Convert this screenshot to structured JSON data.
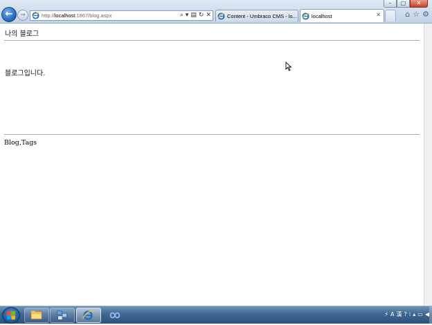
{
  "browser": {
    "window_controls": {
      "minimize": "–",
      "maximize": "□",
      "close": "✕"
    },
    "back_glyph": "←",
    "forward_glyph": "→",
    "url_prefix": "http://",
    "url_host": "localhost",
    "url_rest": ":1867/blog.aspx",
    "address_tools": [
      "⌕",
      "▾",
      "▤",
      "↻",
      "✕"
    ],
    "tabs": [
      {
        "title": "Content - Umbraco CMS - lo...",
        "active": false
      },
      {
        "title": "localhost",
        "active": true,
        "close": "✕"
      }
    ],
    "right_icons": [
      "⌂",
      "☆",
      "⚙"
    ]
  },
  "page": {
    "site_title": "나의 블로그",
    "body_text": "블로그입니다.",
    "footer_text": "Blog,Tags"
  },
  "taskbar": {
    "buttons": [
      {
        "name": "explorer",
        "active": false
      },
      {
        "name": "app",
        "active": false
      },
      {
        "name": "internet-explorer",
        "active": true
      },
      {
        "name": "visual-studio",
        "active": false
      }
    ],
    "tray": [
      "⚡",
      "A",
      "漢",
      "?",
      "⁞",
      "▴",
      "▭",
      "◀"
    ]
  },
  "colors": {
    "ie_blue": "#1f6fc5",
    "ie_yellow": "#f2c12e",
    "taskbar": "#3f6690"
  }
}
